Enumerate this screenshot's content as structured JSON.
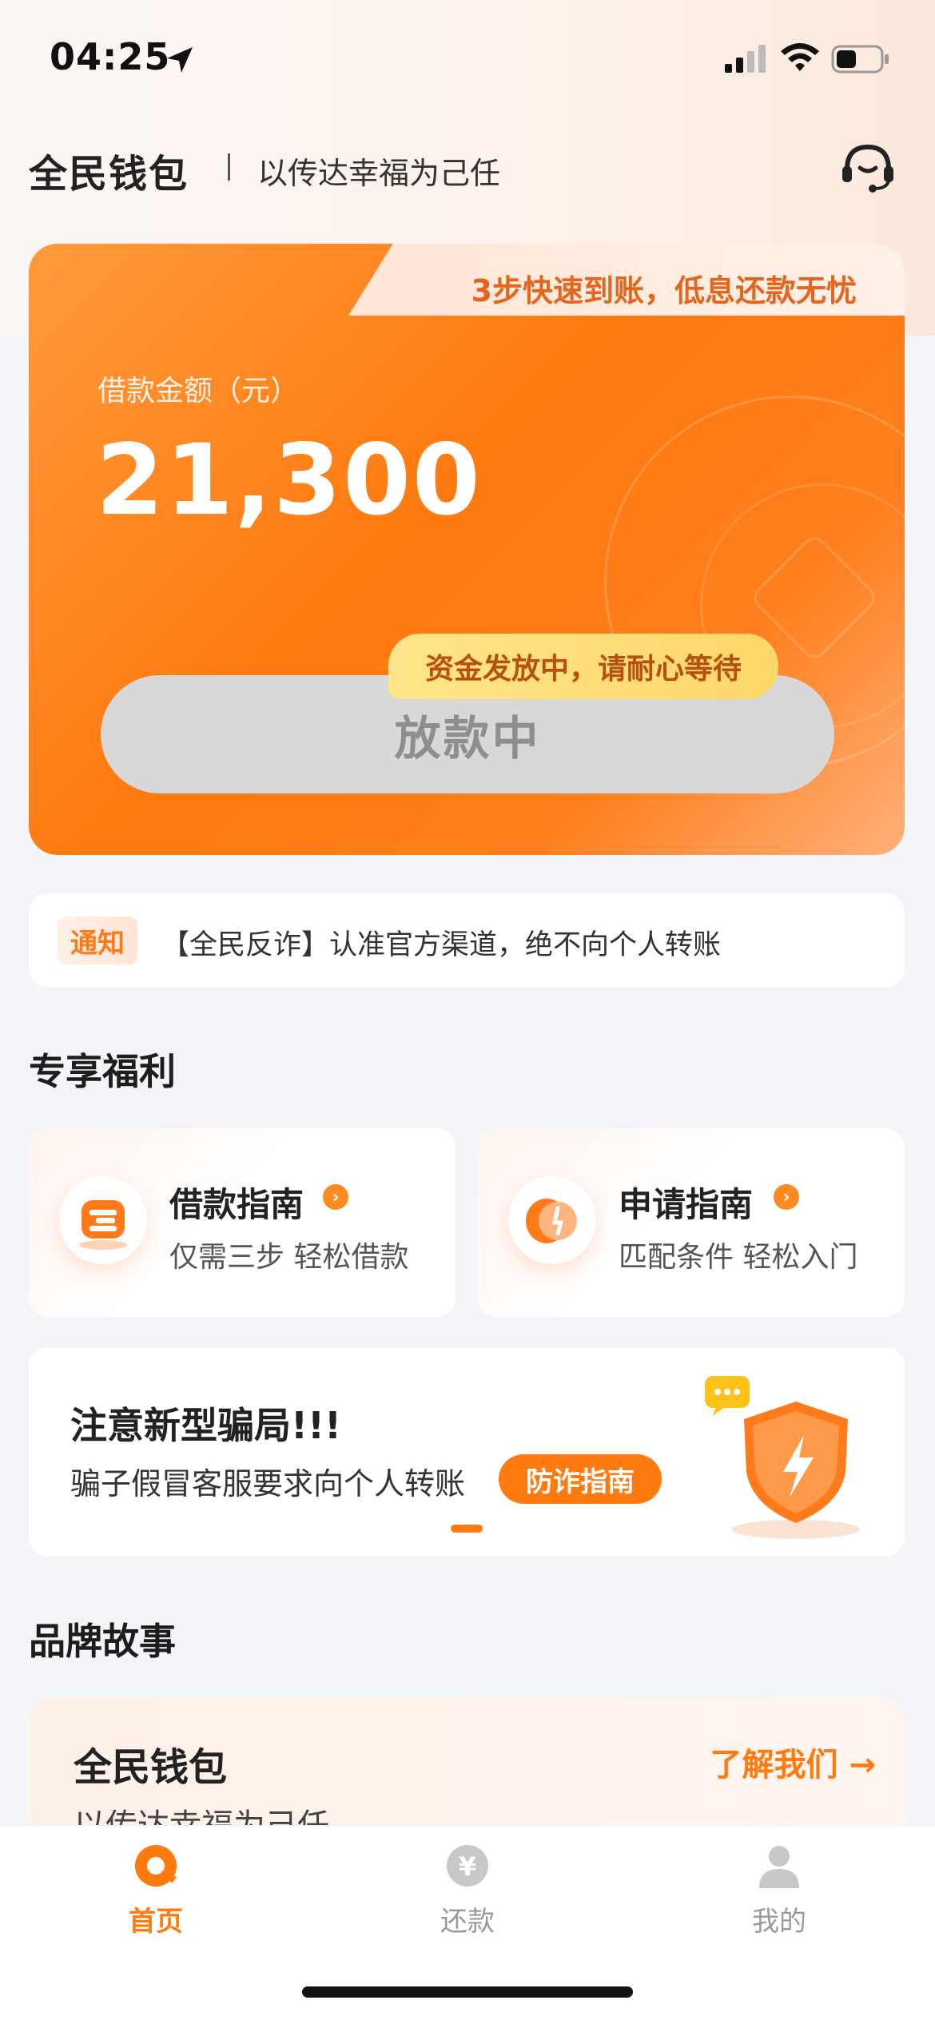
{
  "status_bar": {
    "time": "04:25"
  },
  "header": {
    "brand": "全民钱包",
    "slogan": "以传达幸福为己任"
  },
  "loan_card": {
    "tab_text": "3步快速到账，低息还款无忧",
    "amount_label": "借款金额（元）",
    "amount": "21,300",
    "button_label": "放款中",
    "tip": "资金发放中，请耐心等待"
  },
  "notice": {
    "tag": "通知",
    "text": "【全民反诈】认准官方渠道，绝不向个人转账"
  },
  "benefits": {
    "title": "专享福利",
    "items": [
      {
        "title": "借款指南",
        "subtitle": "仅需三步 轻松借款"
      },
      {
        "title": "申请指南",
        "subtitle": "匹配条件 轻松入门"
      }
    ]
  },
  "banner": {
    "title": "注意新型骗局!!!",
    "subtitle": "骗子假冒客服要求向个人转账",
    "button_label": "防诈指南"
  },
  "brand_story": {
    "title": "品牌故事",
    "card_title": "全民钱包",
    "card_subtitle": "以传达幸福为己任",
    "link": "了解我们 →"
  },
  "tabbar": {
    "items": [
      {
        "label": "首页",
        "active": true
      },
      {
        "label": "还款",
        "active": false
      },
      {
        "label": "我的",
        "active": false
      }
    ]
  },
  "colors": {
    "accent": "#ff7a0f",
    "inactive": "#9a9a9a",
    "button_disabled": "#d8d8d8"
  },
  "icons": [
    "location-arrow-icon",
    "signal-icon",
    "wifi-icon",
    "battery-icon",
    "headset-icon",
    "loan-guide-icon",
    "apply-guide-icon",
    "chevron-right-icon",
    "chat-bubble-icon",
    "shield-icon",
    "home-icon",
    "repay-icon",
    "profile-icon"
  ]
}
